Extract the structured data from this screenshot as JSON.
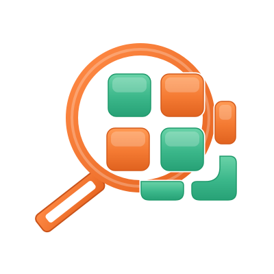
{
  "logo": {
    "icon": "magnifier-with-tile-grid-icon",
    "colors": {
      "orange": "#f47a32",
      "orange_dark": "#d9581a",
      "green": "#3bb78a",
      "green_dark": "#1f9a6c",
      "outline": "#ffffff"
    },
    "tiles": [
      {
        "name": "tile-top-left",
        "color": "green"
      },
      {
        "name": "tile-top-right",
        "color": "orange"
      },
      {
        "name": "tile-right-edge",
        "color": "orange"
      },
      {
        "name": "tile-middle-left",
        "color": "orange"
      },
      {
        "name": "tile-middle-center",
        "color": "green"
      },
      {
        "name": "tile-bottom-center",
        "color": "green"
      },
      {
        "name": "tile-bottom-right",
        "color": "green"
      }
    ]
  }
}
